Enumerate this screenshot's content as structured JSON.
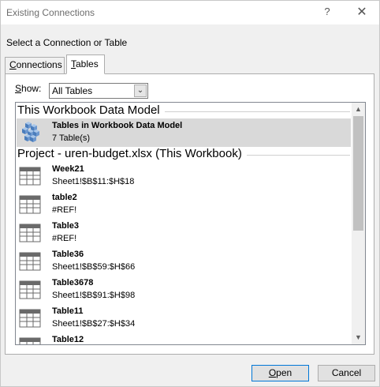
{
  "window": {
    "title": "Existing Connections",
    "help_glyph": "?",
    "close_glyph": "✕"
  },
  "prompt": "Select a Connection or Table",
  "tabs": [
    {
      "label_pre": "",
      "label_key": "C",
      "label_post": "onnections"
    },
    {
      "label_pre": "",
      "label_key": "T",
      "label_post": "ables"
    }
  ],
  "show": {
    "label_key": "S",
    "label_post": "how:",
    "selected": "All Tables",
    "dropdown_glyph": "⌄"
  },
  "sections": [
    {
      "header": "This Workbook Data Model",
      "items": [
        {
          "name": "Tables in Workbook Data Model",
          "detail": "7 Table(s)",
          "icon": "data-model-cube-icon",
          "selected": true
        }
      ]
    },
    {
      "header": "Project - uren-budget.xlsx (This Workbook)",
      "items": [
        {
          "name": "Week21",
          "detail": "Sheet1!$B$11:$H$18",
          "icon": "table-icon"
        },
        {
          "name": "table2",
          "detail": "#REF!",
          "icon": "table-icon"
        },
        {
          "name": "Table3",
          "detail": "#REF!",
          "icon": "table-icon"
        },
        {
          "name": "Table36",
          "detail": "Sheet1!$B$59:$H$66",
          "icon": "table-icon"
        },
        {
          "name": "Table3678",
          "detail": "Sheet1!$B$91:$H$98",
          "icon": "table-icon"
        },
        {
          "name": "Table11",
          "detail": "Sheet1!$B$27:$H$34",
          "icon": "table-icon"
        },
        {
          "name": "Table12",
          "detail": "",
          "icon": "table-icon"
        }
      ]
    }
  ],
  "scrollbar": {
    "up_glyph": "▲",
    "down_glyph": "▼"
  },
  "buttons": {
    "open_key": "O",
    "open_post": "pen",
    "cancel": "Cancel"
  },
  "colors": {
    "selection": "#d9d9d9",
    "focus_border": "#0078d7"
  }
}
